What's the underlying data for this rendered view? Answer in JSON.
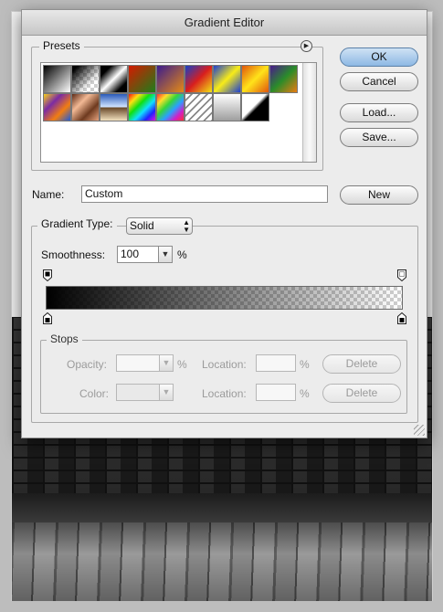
{
  "dialog": {
    "title": "Gradient Editor"
  },
  "presets": {
    "label": "Presets",
    "menu_icon": "triangle-right-icon",
    "swatches": [
      {
        "name": "black-white",
        "style": "linear-gradient(135deg,#000,#fff)"
      },
      {
        "name": "black-transparent",
        "style": "checker-black"
      },
      {
        "name": "black-white-black",
        "style": "linear-gradient(135deg,#000 20%,#fff 50%,#000 80%)"
      },
      {
        "name": "red-green",
        "style": "linear-gradient(135deg,#d41a00,#1c7e1a)"
      },
      {
        "name": "violet-orange",
        "style": "linear-gradient(135deg,#3b1c8e,#e58a14)"
      },
      {
        "name": "blue-red-yellow",
        "style": "linear-gradient(135deg,#1640c6,#d81e1e,#f2e414)"
      },
      {
        "name": "blue-yellow-blue",
        "style": "linear-gradient(135deg,#1d3fd0,#f8ec18,#1d3fd0)"
      },
      {
        "name": "orange-yellow-orange",
        "style": "linear-gradient(135deg,#e0560c,#ffe31a,#e0560c)"
      },
      {
        "name": "violet-green-orange",
        "style": "linear-gradient(135deg,#4a1a8c,#2a8c2a,#ea7c10)"
      },
      {
        "name": "yellow-violet-orange-blue",
        "style": "linear-gradient(135deg,#f6cf1b,#7b2ba4,#f27d11,#1e5bd8)"
      },
      {
        "name": "copper",
        "style": "linear-gradient(135deg,#5e2a16,#f2b995,#6e3a1f,#e6a37e)"
      },
      {
        "name": "chrome",
        "style": "linear-gradient(180deg,#2a5ab8,#cfe3ff 48%,#6a4b2b 52%,#f3e2c0)"
      },
      {
        "name": "spectrum",
        "style": "linear-gradient(135deg,#ff1010,#ffe010,#10e010,#10e0ff,#2020ff,#e010e0)"
      },
      {
        "name": "transparent-rainbow",
        "style": "linear-gradient(135deg,#ff3030,#ffdf2a,#35d63a,#2aa0ff,#d020c8,#ff3030)"
      },
      {
        "name": "transparent-stripes",
        "style": "repeating-linear-gradient(135deg,#fff 0 4px,#888 4px 6px)"
      },
      {
        "name": "neutral-density",
        "style": "linear-gradient(180deg,#fff,#9e9e9e)"
      },
      {
        "name": "black-white-diag",
        "style": "linear-gradient(135deg,#fff 45%,#000 55%)"
      }
    ]
  },
  "buttons": {
    "ok": "OK",
    "cancel": "Cancel",
    "load": "Load...",
    "save": "Save...",
    "new": "New",
    "delete": "Delete"
  },
  "name_field": {
    "label": "Name:",
    "value": "Custom"
  },
  "gradient_type": {
    "label": "Gradient Type:",
    "value": "Solid"
  },
  "smoothness": {
    "label": "Smoothness:",
    "value": "100",
    "unit": "%"
  },
  "gradient": {
    "from_color": "#000000",
    "to_color": "transparent"
  },
  "stops": {
    "label": "Stops",
    "opacity_label": "Opacity:",
    "opacity_value": "",
    "color_label": "Color:",
    "location_label": "Location:",
    "location_value": "",
    "percent": "%"
  },
  "colors": {
    "default_button": "#8db8e4",
    "dialog_bg": "#ececec"
  }
}
